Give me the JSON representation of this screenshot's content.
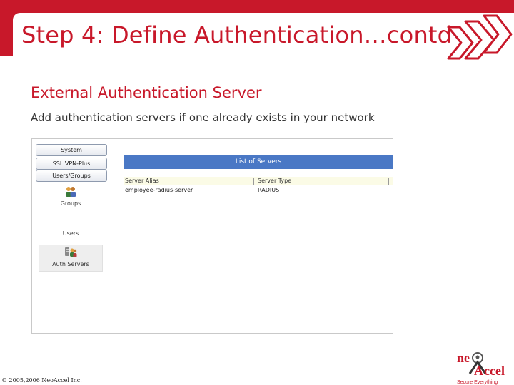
{
  "slide": {
    "title": "Step 4: Define Authentication…contd",
    "heading": "External Authentication Server",
    "description": "Add authentication servers if one already exists in your network",
    "copyright": "© 2005,2006 NeoAccel Inc.",
    "logo": {
      "text_part1": "ne",
      "text_part2": "ccel",
      "tagline": "Secure Everything"
    },
    "colors": {
      "brand_red": "#c8182a",
      "panel_blue": "#4a78c5"
    }
  },
  "app": {
    "sidebar": {
      "buttons": [
        {
          "label": "System"
        },
        {
          "label": "SSL VPN-Plus"
        },
        {
          "label": "Users/Groups"
        }
      ],
      "items": [
        {
          "label": "Groups",
          "icon": "groups-icon"
        },
        {
          "label": "Users",
          "icon": "users-icon"
        },
        {
          "label": "Auth Servers",
          "icon": "auth-servers-icon",
          "selected": true
        }
      ]
    },
    "panel": {
      "title": "List of Servers",
      "columns": [
        "Server Alias",
        "Server Type"
      ],
      "rows": [
        [
          "employee-radius-server",
          "RADIUS"
        ]
      ]
    }
  }
}
